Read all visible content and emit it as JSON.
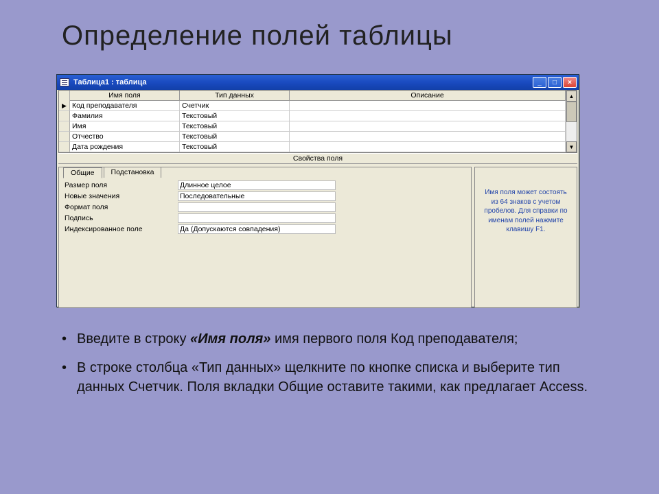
{
  "slide_title": "Определение полей таблицы",
  "window": {
    "title": "Таблица1 : таблица",
    "columns": {
      "name": "Имя поля",
      "type": "Тип данных",
      "desc": "Описание"
    },
    "rows": [
      {
        "selector": "▶",
        "name": "Код преподавателя",
        "type": "Счетчик",
        "desc": ""
      },
      {
        "selector": "",
        "name": "Фамилия",
        "type": "Текстовый",
        "desc": ""
      },
      {
        "selector": "",
        "name": "Имя",
        "type": "Текстовый",
        "desc": ""
      },
      {
        "selector": "",
        "name": "Отчество",
        "type": "Текстовый",
        "desc": ""
      },
      {
        "selector": "",
        "name": "Дата рождения",
        "type": "Текстовый",
        "desc": ""
      }
    ],
    "midbar": "Свойства поля",
    "tabs": {
      "general": "Общие",
      "lookup": "Подстановка"
    },
    "props": [
      {
        "label": "Размер поля",
        "value": "Длинное целое"
      },
      {
        "label": "Новые значения",
        "value": "Последовательные"
      },
      {
        "label": "Формат поля",
        "value": ""
      },
      {
        "label": "Подпись",
        "value": ""
      },
      {
        "label": "Индексированное поле",
        "value": "Да (Допускаются совпадения)"
      }
    ],
    "help_text": "Имя поля может состоять из 64 знаков с учетом пробелов. Для справки по именам полей нажмите клавишу F1."
  },
  "bullets": {
    "b1_a": "Введите в строку ",
    "b1_bold": "«Имя поля»",
    "b1_b": " имя первого поля Код преподавателя;",
    "b2": "В строке столбца «Тип данных» щелкните по кнопке списка и выберите тип данных Счетчик. Поля вкладки Общие оставите такими, как предлагает Access."
  }
}
